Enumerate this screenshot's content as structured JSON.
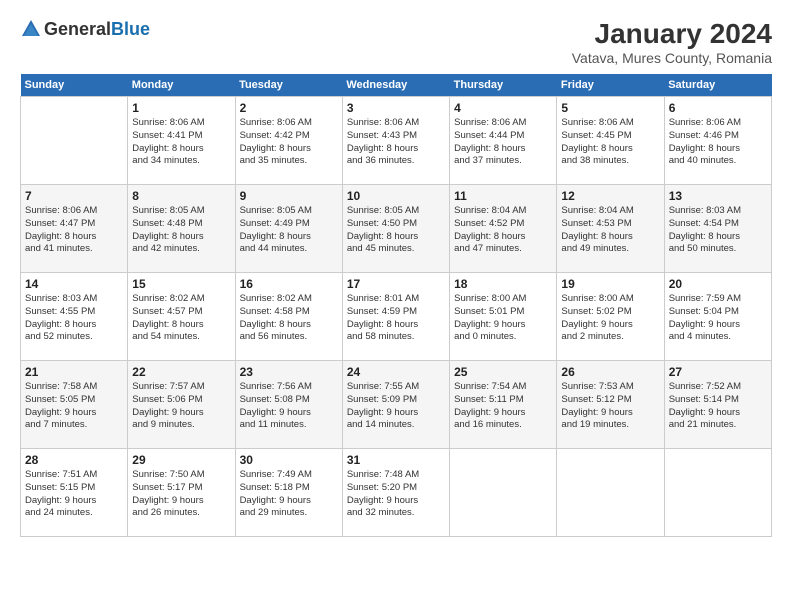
{
  "logo": {
    "general": "General",
    "blue": "Blue"
  },
  "header": {
    "title": "January 2024",
    "subtitle": "Vatava, Mures County, Romania"
  },
  "weekdays": [
    "Sunday",
    "Monday",
    "Tuesday",
    "Wednesday",
    "Thursday",
    "Friday",
    "Saturday"
  ],
  "weeks": [
    [
      {
        "day": "",
        "sunrise": "",
        "sunset": "",
        "daylight": ""
      },
      {
        "day": "1",
        "sunrise": "Sunrise: 8:06 AM",
        "sunset": "Sunset: 4:41 PM",
        "daylight": "Daylight: 8 hours and 34 minutes."
      },
      {
        "day": "2",
        "sunrise": "Sunrise: 8:06 AM",
        "sunset": "Sunset: 4:42 PM",
        "daylight": "Daylight: 8 hours and 35 minutes."
      },
      {
        "day": "3",
        "sunrise": "Sunrise: 8:06 AM",
        "sunset": "Sunset: 4:43 PM",
        "daylight": "Daylight: 8 hours and 36 minutes."
      },
      {
        "day": "4",
        "sunrise": "Sunrise: 8:06 AM",
        "sunset": "Sunset: 4:44 PM",
        "daylight": "Daylight: 8 hours and 37 minutes."
      },
      {
        "day": "5",
        "sunrise": "Sunrise: 8:06 AM",
        "sunset": "Sunset: 4:45 PM",
        "daylight": "Daylight: 8 hours and 38 minutes."
      },
      {
        "day": "6",
        "sunrise": "Sunrise: 8:06 AM",
        "sunset": "Sunset: 4:46 PM",
        "daylight": "Daylight: 8 hours and 40 minutes."
      }
    ],
    [
      {
        "day": "7",
        "sunrise": "Sunrise: 8:06 AM",
        "sunset": "Sunset: 4:47 PM",
        "daylight": "Daylight: 8 hours and 41 minutes."
      },
      {
        "day": "8",
        "sunrise": "Sunrise: 8:05 AM",
        "sunset": "Sunset: 4:48 PM",
        "daylight": "Daylight: 8 hours and 42 minutes."
      },
      {
        "day": "9",
        "sunrise": "Sunrise: 8:05 AM",
        "sunset": "Sunset: 4:49 PM",
        "daylight": "Daylight: 8 hours and 44 minutes."
      },
      {
        "day": "10",
        "sunrise": "Sunrise: 8:05 AM",
        "sunset": "Sunset: 4:50 PM",
        "daylight": "Daylight: 8 hours and 45 minutes."
      },
      {
        "day": "11",
        "sunrise": "Sunrise: 8:04 AM",
        "sunset": "Sunset: 4:52 PM",
        "daylight": "Daylight: 8 hours and 47 minutes."
      },
      {
        "day": "12",
        "sunrise": "Sunrise: 8:04 AM",
        "sunset": "Sunset: 4:53 PM",
        "daylight": "Daylight: 8 hours and 49 minutes."
      },
      {
        "day": "13",
        "sunrise": "Sunrise: 8:03 AM",
        "sunset": "Sunset: 4:54 PM",
        "daylight": "Daylight: 8 hours and 50 minutes."
      }
    ],
    [
      {
        "day": "14",
        "sunrise": "Sunrise: 8:03 AM",
        "sunset": "Sunset: 4:55 PM",
        "daylight": "Daylight: 8 hours and 52 minutes."
      },
      {
        "day": "15",
        "sunrise": "Sunrise: 8:02 AM",
        "sunset": "Sunset: 4:57 PM",
        "daylight": "Daylight: 8 hours and 54 minutes."
      },
      {
        "day": "16",
        "sunrise": "Sunrise: 8:02 AM",
        "sunset": "Sunset: 4:58 PM",
        "daylight": "Daylight: 8 hours and 56 minutes."
      },
      {
        "day": "17",
        "sunrise": "Sunrise: 8:01 AM",
        "sunset": "Sunset: 4:59 PM",
        "daylight": "Daylight: 8 hours and 58 minutes."
      },
      {
        "day": "18",
        "sunrise": "Sunrise: 8:00 AM",
        "sunset": "Sunset: 5:01 PM",
        "daylight": "Daylight: 9 hours and 0 minutes."
      },
      {
        "day": "19",
        "sunrise": "Sunrise: 8:00 AM",
        "sunset": "Sunset: 5:02 PM",
        "daylight": "Daylight: 9 hours and 2 minutes."
      },
      {
        "day": "20",
        "sunrise": "Sunrise: 7:59 AM",
        "sunset": "Sunset: 5:04 PM",
        "daylight": "Daylight: 9 hours and 4 minutes."
      }
    ],
    [
      {
        "day": "21",
        "sunrise": "Sunrise: 7:58 AM",
        "sunset": "Sunset: 5:05 PM",
        "daylight": "Daylight: 9 hours and 7 minutes."
      },
      {
        "day": "22",
        "sunrise": "Sunrise: 7:57 AM",
        "sunset": "Sunset: 5:06 PM",
        "daylight": "Daylight: 9 hours and 9 minutes."
      },
      {
        "day": "23",
        "sunrise": "Sunrise: 7:56 AM",
        "sunset": "Sunset: 5:08 PM",
        "daylight": "Daylight: 9 hours and 11 minutes."
      },
      {
        "day": "24",
        "sunrise": "Sunrise: 7:55 AM",
        "sunset": "Sunset: 5:09 PM",
        "daylight": "Daylight: 9 hours and 14 minutes."
      },
      {
        "day": "25",
        "sunrise": "Sunrise: 7:54 AM",
        "sunset": "Sunset: 5:11 PM",
        "daylight": "Daylight: 9 hours and 16 minutes."
      },
      {
        "day": "26",
        "sunrise": "Sunrise: 7:53 AM",
        "sunset": "Sunset: 5:12 PM",
        "daylight": "Daylight: 9 hours and 19 minutes."
      },
      {
        "day": "27",
        "sunrise": "Sunrise: 7:52 AM",
        "sunset": "Sunset: 5:14 PM",
        "daylight": "Daylight: 9 hours and 21 minutes."
      }
    ],
    [
      {
        "day": "28",
        "sunrise": "Sunrise: 7:51 AM",
        "sunset": "Sunset: 5:15 PM",
        "daylight": "Daylight: 9 hours and 24 minutes."
      },
      {
        "day": "29",
        "sunrise": "Sunrise: 7:50 AM",
        "sunset": "Sunset: 5:17 PM",
        "daylight": "Daylight: 9 hours and 26 minutes."
      },
      {
        "day": "30",
        "sunrise": "Sunrise: 7:49 AM",
        "sunset": "Sunset: 5:18 PM",
        "daylight": "Daylight: 9 hours and 29 minutes."
      },
      {
        "day": "31",
        "sunrise": "Sunrise: 7:48 AM",
        "sunset": "Sunset: 5:20 PM",
        "daylight": "Daylight: 9 hours and 32 minutes."
      },
      {
        "day": "",
        "sunrise": "",
        "sunset": "",
        "daylight": ""
      },
      {
        "day": "",
        "sunrise": "",
        "sunset": "",
        "daylight": ""
      },
      {
        "day": "",
        "sunrise": "",
        "sunset": "",
        "daylight": ""
      }
    ]
  ]
}
